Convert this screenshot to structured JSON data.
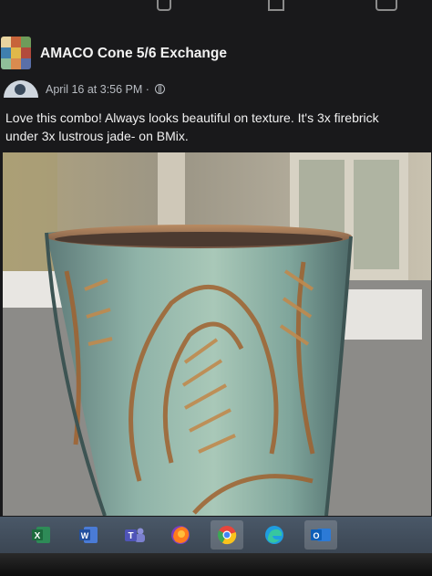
{
  "post": {
    "group_name": "AMACO Cone 5/6 Exchange",
    "timestamp": "April 16 at 3:56 PM",
    "separator": " · ",
    "audience_icon": "globe-icon",
    "text": "Love this combo!  Always looks beautiful on texture.  It's 3x firebrick\nunder 3x lustrous jade- on BMix."
  },
  "photo": {
    "subject_icon": "carved-ceramic-cup-image"
  },
  "taskbar": {
    "apps": [
      {
        "name": "excel-icon",
        "glyph": "X"
      },
      {
        "name": "word-icon",
        "glyph": "W"
      },
      {
        "name": "teams-icon",
        "glyph": "T"
      },
      {
        "name": "firefox-icon",
        "glyph": ""
      },
      {
        "name": "chrome-icon",
        "glyph": ""
      },
      {
        "name": "edge-icon",
        "glyph": ""
      },
      {
        "name": "outlook-icon",
        "glyph": "O"
      }
    ]
  },
  "colors": {
    "background": "#19191b",
    "text": "#f0f0f0",
    "meta_text": "#b8bcc2",
    "taskbar": "#44505e"
  }
}
